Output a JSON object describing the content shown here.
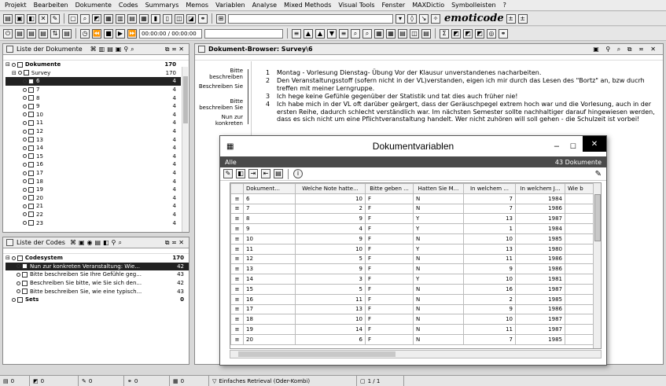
{
  "menu": [
    "Projekt",
    "Bearbeiten",
    "Dokumente",
    "Codes",
    "Summarys",
    "Memos",
    "Variablen",
    "Analyse",
    "Mixed Methods",
    "Visual Tools",
    "Fenster",
    "MAXDictio",
    "Symbolleisten",
    "?"
  ],
  "toolbar": {
    "time": "00:00:00 / 00:00:00",
    "logo": "emoticode"
  },
  "doc_list": {
    "title": "Liste der Dokumente",
    "root": {
      "label": "Dokumente",
      "count": "170"
    },
    "group": {
      "label": "Survey",
      "count": "170"
    },
    "docs": [
      {
        "label": "6",
        "count": "4"
      },
      {
        "label": "7",
        "count": "4"
      },
      {
        "label": "8",
        "count": "4"
      },
      {
        "label": "9",
        "count": "4"
      },
      {
        "label": "10",
        "count": "4"
      },
      {
        "label": "11",
        "count": "4"
      },
      {
        "label": "12",
        "count": "4"
      },
      {
        "label": "13",
        "count": "4"
      },
      {
        "label": "14",
        "count": "4"
      },
      {
        "label": "15",
        "count": "4"
      },
      {
        "label": "16",
        "count": "4"
      },
      {
        "label": "17",
        "count": "4"
      },
      {
        "label": "18",
        "count": "4"
      },
      {
        "label": "19",
        "count": "4"
      },
      {
        "label": "20",
        "count": "4"
      },
      {
        "label": "21",
        "count": "4"
      },
      {
        "label": "22",
        "count": "4"
      },
      {
        "label": "23",
        "count": "4"
      }
    ]
  },
  "code_list": {
    "title": "Liste der Codes",
    "root": {
      "label": "Codesystem",
      "count": "170"
    },
    "codes": [
      {
        "label": "Nun zur konkreten Veranstaltung: Wie...",
        "count": "42"
      },
      {
        "label": "Bitte beschreiben Sie Ihre Gefühle geg...",
        "count": "43"
      },
      {
        "label": "Beschreiben Sie bitte, wie Sie sich den...",
        "count": "42"
      },
      {
        "label": "Bitte beschreiben Sie, wie eine typisch...",
        "count": "43"
      }
    ],
    "sets": {
      "label": "Sets",
      "count": "0"
    }
  },
  "browser": {
    "title": "Dokument-Browser: Survey\\6",
    "memos": [
      "Bitte beschreiben",
      "Beschreiben Sie",
      "Bitte beschreiben Sie",
      "Nun zur konkreten"
    ],
    "paragraphs": [
      {
        "n": "1",
        "text": "Montag - Vorlesung Dienstag- Übung  Vor der Klausur unverstandenes nacharbeiten."
      },
      {
        "n": "2",
        "text": "Den Veranstaltungsstoff (sofern nicht in der VL)verstanden, eigen ich mir durch das Lesen des \"Bortz\" an, bzw ducrh treffen mit meiner Lerngruppe."
      },
      {
        "n": "3",
        "text": "Ich hege keine Gefühle gegenüber der Statistik und tat dies auch früher nie!"
      },
      {
        "n": "4",
        "text": "Ich habe mich in der VL oft darüber geärgert, dass der Geräuschpegel extrem hoch war und die Vorlesung, auch in der ersten Reihe, dadurch schlecht verständlich war. Im nächsten Semester sollte nachhaltiger darauf hingewiesen werden, dass es sich nicht um eine Pflichtveranstaltung handelt. Wer nicht zuhören will soll gehen - die Schulzeit ist vorbei!"
      }
    ]
  },
  "dialog": {
    "title": "Dokumentvariablen",
    "filter": "Alle",
    "count": "43 Dokumente",
    "columns": [
      "Dokument...",
      "Welche Note hatte...",
      "Bitte geben ...",
      "Hatten Sie M...",
      "In welchem ...",
      "In welchem J...",
      "Wie b"
    ],
    "rows": [
      [
        "6",
        "10",
        "F",
        "N",
        "7",
        "1984"
      ],
      [
        "7",
        "2",
        "F",
        "N",
        "7",
        "1986"
      ],
      [
        "8",
        "9",
        "F",
        "Y",
        "13",
        "1987"
      ],
      [
        "9",
        "4",
        "F",
        "Y",
        "1",
        "1984"
      ],
      [
        "10",
        "9",
        "F",
        "N",
        "10",
        "1985"
      ],
      [
        "11",
        "10",
        "F",
        "Y",
        "13",
        "1980"
      ],
      [
        "12",
        "5",
        "F",
        "N",
        "11",
        "1986"
      ],
      [
        "13",
        "9",
        "F",
        "N",
        "9",
        "1986"
      ],
      [
        "14",
        "3",
        "F",
        "Y",
        "10",
        "1981"
      ],
      [
        "15",
        "5",
        "F",
        "N",
        "16",
        "1987"
      ],
      [
        "16",
        "11",
        "F",
        "N",
        "2",
        "1985"
      ],
      [
        "17",
        "13",
        "F",
        "N",
        "9",
        "1986"
      ],
      [
        "18",
        "10",
        "F",
        "N",
        "10",
        "1987"
      ],
      [
        "19",
        "14",
        "F",
        "N",
        "11",
        "1987"
      ],
      [
        "20",
        "6",
        "F",
        "N",
        "7",
        "1985"
      ]
    ]
  },
  "status": [
    "0",
    "0",
    "0",
    "0",
    "0",
    "Einfaches Retrieval (Oder-Kombi)",
    "1 / 1"
  ]
}
